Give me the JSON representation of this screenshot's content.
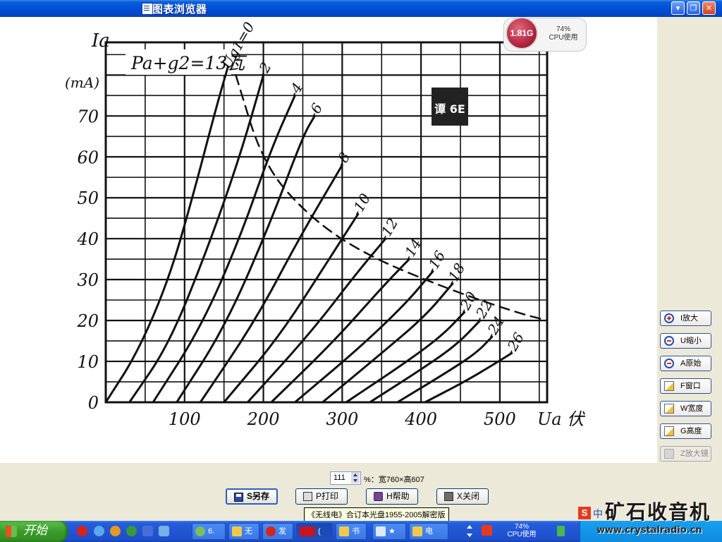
{
  "window": {
    "title": "图表浏览器",
    "minimize_glyph": "▾",
    "restore_glyph": "❐",
    "close_glyph": "✕"
  },
  "cpu_widget": {
    "memory": "1.81G",
    "cpu_percent": "74%",
    "cpu_label": "CPU使用"
  },
  "chart_data": {
    "type": "line",
    "title": "Pa+g2=13瓦",
    "xlabel": "Ua 伏",
    "ylabel": "Ia",
    "yunit": "(mA)",
    "x_ticks": [
      "100",
      "200",
      "300",
      "400",
      "500"
    ],
    "y_ticks": [
      "0",
      "10",
      "20",
      "30",
      "40",
      "50",
      "60",
      "70"
    ],
    "xlim": [
      0,
      560
    ],
    "ylim": [
      0,
      88
    ],
    "grid": true,
    "stamp_text": "谭 6E",
    "series": [
      {
        "name": "Ug1=0",
        "values": [
          [
            0,
            0
          ],
          [
            40,
            12
          ],
          [
            80,
            30
          ],
          [
            110,
            50
          ],
          [
            140,
            72
          ],
          [
            155,
            82
          ]
        ]
      },
      {
        "name": "-2",
        "values": [
          [
            30,
            0
          ],
          [
            80,
            14
          ],
          [
            130,
            38
          ],
          [
            170,
            60
          ],
          [
            200,
            80
          ]
        ]
      },
      {
        "name": "-4",
        "values": [
          [
            60,
            0
          ],
          [
            120,
            18
          ],
          [
            170,
            40
          ],
          [
            210,
            62
          ],
          [
            240,
            75
          ]
        ]
      },
      {
        "name": "-6",
        "values": [
          [
            90,
            0
          ],
          [
            150,
            18
          ],
          [
            205,
            42
          ],
          [
            250,
            65
          ],
          [
            265,
            70
          ]
        ]
      },
      {
        "name": "-8",
        "values": [
          [
            120,
            0
          ],
          [
            190,
            20
          ],
          [
            245,
            40
          ],
          [
            300,
            58
          ]
        ]
      },
      {
        "name": "-10",
        "values": [
          [
            150,
            0
          ],
          [
            220,
            16
          ],
          [
            280,
            34
          ],
          [
            320,
            46
          ]
        ]
      },
      {
        "name": "-12",
        "values": [
          [
            180,
            0
          ],
          [
            260,
            17
          ],
          [
            320,
            32
          ],
          [
            355,
            40
          ]
        ]
      },
      {
        "name": "-14",
        "values": [
          [
            210,
            0
          ],
          [
            290,
            15
          ],
          [
            350,
            28
          ],
          [
            385,
            35
          ]
        ]
      },
      {
        "name": "-16",
        "values": [
          [
            240,
            0
          ],
          [
            320,
            13
          ],
          [
            380,
            24
          ],
          [
            415,
            32
          ]
        ]
      },
      {
        "name": "-18",
        "values": [
          [
            275,
            0
          ],
          [
            350,
            12
          ],
          [
            405,
            21
          ],
          [
            440,
            29
          ]
        ]
      },
      {
        "name": "-20",
        "values": [
          [
            305,
            0
          ],
          [
            375,
            9
          ],
          [
            425,
            16
          ],
          [
            455,
            22
          ]
        ]
      },
      {
        "name": "-22",
        "values": [
          [
            335,
            0
          ],
          [
            400,
            8
          ],
          [
            445,
            14
          ],
          [
            475,
            20
          ]
        ]
      },
      {
        "name": "-24",
        "values": [
          [
            370,
            0
          ],
          [
            430,
            7
          ],
          [
            470,
            12
          ],
          [
            490,
            16
          ]
        ]
      },
      {
        "name": "-26",
        "values": [
          [
            405,
            0
          ],
          [
            455,
            5
          ],
          [
            490,
            9
          ],
          [
            515,
            12
          ]
        ]
      },
      {
        "name": "Pa+g2",
        "dashed": true,
        "values": [
          [
            165,
            80
          ],
          [
            200,
            58
          ],
          [
            260,
            45
          ],
          [
            330,
            36
          ],
          [
            430,
            28
          ],
          [
            520,
            22
          ],
          [
            560,
            20
          ]
        ]
      }
    ]
  },
  "side_tools": [
    {
      "label": "I放大",
      "icon": "zoom-in-icon"
    },
    {
      "label": "U缩小",
      "icon": "zoom-out-icon"
    },
    {
      "label": "A原始",
      "icon": "zoom-reset-icon"
    },
    {
      "label": "F窗口",
      "icon": "fit-window-icon"
    },
    {
      "label": "W宽度",
      "icon": "fit-width-icon"
    },
    {
      "label": "G高度",
      "icon": "fit-height-icon"
    },
    {
      "label": "Z放大镜",
      "icon": "magnifier-icon"
    }
  ],
  "zoom": {
    "value": "111",
    "dimensions": "%：宽760×高607"
  },
  "actions": {
    "save": "S另存",
    "print": "P打印",
    "help": "H帮助",
    "close": "X关闭"
  },
  "tooltip": "《无线电》合订本光盘1955-2005解密版",
  "taskbar": {
    "start": "开始",
    "tasks": [
      "6.",
      "无",
      "发",
      "(",
      "书",
      "★",
      "电"
    ],
    "cpu_percent": "74%",
    "cpu_label": "CPU使用"
  },
  "watermark": {
    "title": "矿石收音机",
    "url": "www.crystalradio.cn"
  },
  "ime": {
    "logo": "S",
    "char": "中"
  },
  "colors": {
    "titlebar": "#0050d8",
    "start": "#3a9d2a",
    "chart_ink": "#111111"
  }
}
